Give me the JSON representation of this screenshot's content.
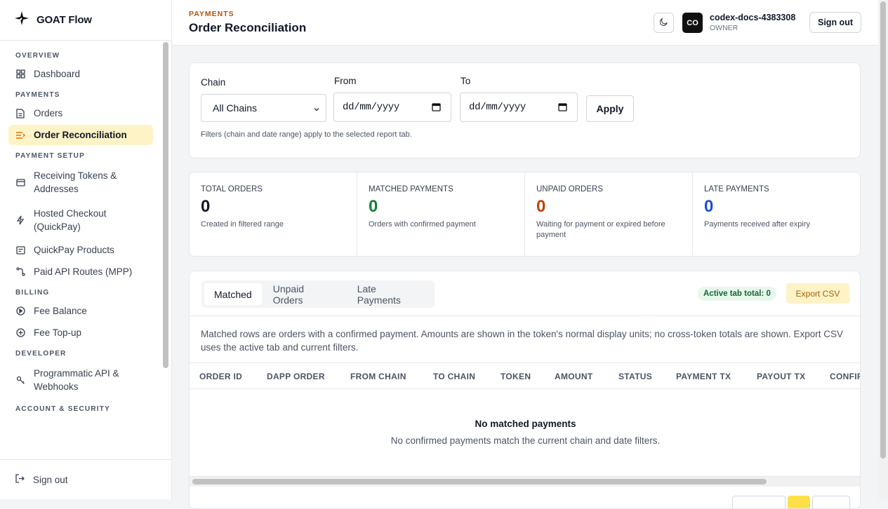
{
  "brand": {
    "name": "GOAT Flow"
  },
  "sidebar": {
    "sections": {
      "overview": "OVERVIEW",
      "payments": "PAYMENTS",
      "payment_setup": "PAYMENT SETUP",
      "billing": "BILLING",
      "developer": "DEVELOPER",
      "account_security": "ACCOUNT & SECURITY"
    },
    "items": {
      "dashboard": "Dashboard",
      "orders": "Orders",
      "order_reconciliation": "Order Reconciliation",
      "receiving_tokens_1": "Receiving Tokens &",
      "receiving_tokens_2": "Addresses",
      "hosted_checkout_1": "Hosted Checkout",
      "hosted_checkout_2": "(QuickPay)",
      "quickpay_products": "QuickPay Products",
      "paid_api_routes": "Paid API Routes (MPP)",
      "fee_balance": "Fee Balance",
      "fee_topup": "Fee Top-up",
      "programmatic_api_1": "Programmatic API &",
      "programmatic_api_2": "Webhooks"
    },
    "sign_out": "Sign out",
    "active_color": "#fef3c7"
  },
  "header": {
    "kicker": "PAYMENTS",
    "title": "Order Reconciliation",
    "avatar": "CO",
    "user_name": "codex-docs-4383308",
    "user_role": "OWNER",
    "sign_out": "Sign out"
  },
  "filters": {
    "chain_label": "Chain",
    "chain_value": "All Chains",
    "from_label": "From",
    "from_value": "dd/mm/yyyy",
    "to_label": "To",
    "to_value": "dd/mm/yyyy",
    "apply": "Apply",
    "hint": "Filters (chain and date range) apply to the selected report tab."
  },
  "stats": [
    {
      "label": "TOTAL ORDERS",
      "value": "0",
      "desc": "Created in filtered range",
      "color": "#111827"
    },
    {
      "label": "MATCHED PAYMENTS",
      "value": "0",
      "desc": "Orders with confirmed payment",
      "color": "#15803d"
    },
    {
      "label": "UNPAID ORDERS",
      "value": "0",
      "desc": "Waiting for payment or expired before payment",
      "color": "#c2410c"
    },
    {
      "label": "LATE PAYMENTS",
      "value": "0",
      "desc": "Payments received after expiry",
      "color": "#1d4ed8"
    }
  ],
  "report": {
    "tabs": [
      "Matched",
      "Unpaid Orders",
      "Late Payments"
    ],
    "active_total": "Active tab total: 0",
    "export": "Export CSV",
    "note": "Matched rows are orders with a confirmed payment. Amounts are shown in the token's normal display units; no cross-token totals are shown. Export CSV uses the active tab and current filters.",
    "columns": [
      "ORDER ID",
      "DAPP ORDER",
      "FROM CHAIN",
      "TO CHAIN",
      "TOKEN",
      "AMOUNT",
      "STATUS",
      "PAYMENT TX",
      "PAYOUT TX",
      "CONFIR"
    ],
    "empty_title": "No matched payments",
    "empty_sub": "No confirmed payments match the current chain and date filters."
  }
}
